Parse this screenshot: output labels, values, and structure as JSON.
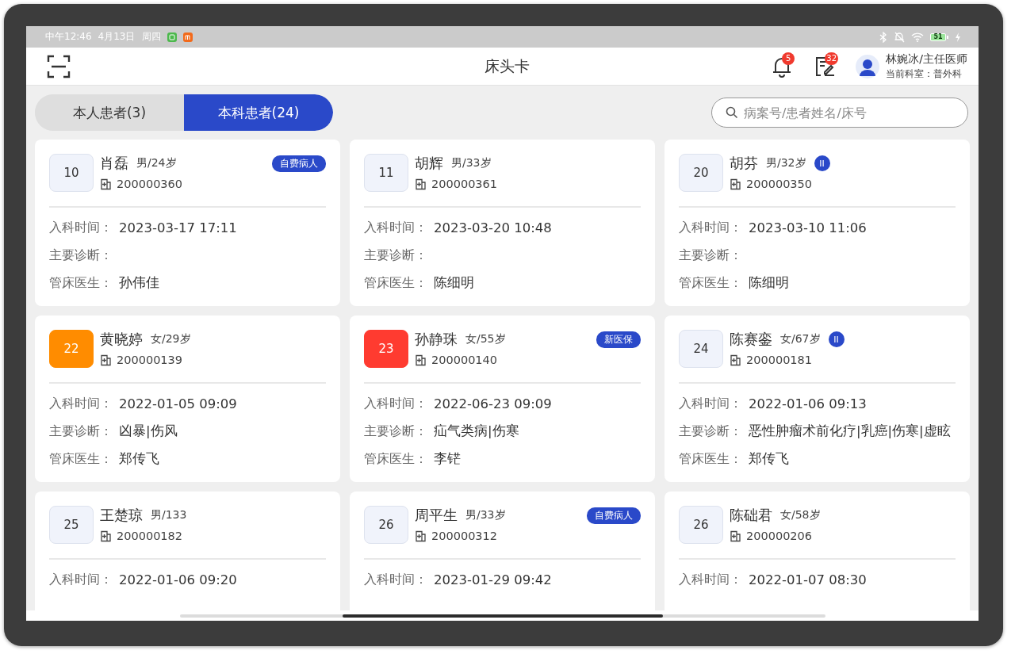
{
  "status_bar": {
    "time": "中午12:46",
    "date": "4月13日",
    "weekday": "周四",
    "battery": "51"
  },
  "header": {
    "title": "床头卡",
    "notifications": "5",
    "tasks": "32",
    "user": "林婉冰/主任医师",
    "department": "当前科室：普外科"
  },
  "tabs": [
    {
      "label": "本人患者(3)",
      "selected": false
    },
    {
      "label": "本科患者(24)",
      "selected": true
    }
  ],
  "search": {
    "placeholder": "病案号/患者姓名/床号"
  },
  "cards": [
    {
      "bed": "10",
      "color": "#f0f3fb",
      "name": "肖磊",
      "sex_age": "男/24岁",
      "tag": {
        "kind": "pill",
        "text": "自费病人"
      },
      "record_no": "200000360",
      "fields": [
        {
          "label": "入科时间：",
          "value": "2023-03-17 17:11"
        },
        {
          "label": "主要诊断："
        },
        {
          "label": "管床医生：",
          "value": "孙伟佳"
        }
      ]
    },
    {
      "bed": "11",
      "color": "#f0f3fb",
      "name": "胡辉",
      "sex_age": "男/33岁",
      "record_no": "200000361",
      "fields": [
        {
          "label": "入科时间：",
          "value": "2023-03-20 10:48"
        },
        {
          "label": "主要诊断："
        },
        {
          "label": "管床医生：",
          "value": "陈细明"
        }
      ]
    },
    {
      "bed": "20",
      "color": "#f0f3fb",
      "name": "胡芬",
      "sex_age": "男/32岁",
      "tag": {
        "kind": "circle",
        "text": "II"
      },
      "record_no": "200000350",
      "fields": [
        {
          "label": "入科时间：",
          "value": "2023-03-10 11:06"
        },
        {
          "label": "主要诊断："
        },
        {
          "label": "管床医生：",
          "value": "陈细明"
        }
      ]
    },
    {
      "bed": "22",
      "color": "#ff8c00",
      "name": "黄晓婷",
      "sex_age": "女/29岁",
      "record_no": "200000139",
      "fields": [
        {
          "label": "入科时间：",
          "value": "2022-01-05 09:09"
        },
        {
          "label": "主要诊断：",
          "value": "凶暴|伤风"
        },
        {
          "label": "管床医生：",
          "value": "郑传飞"
        }
      ]
    },
    {
      "bed": "23",
      "color": "#ff3b30",
      "name": "孙静珠",
      "sex_age": "女/55岁",
      "tag": {
        "kind": "pill",
        "text": "新医保"
      },
      "record_no": "200000140",
      "fields": [
        {
          "label": "入科时间：",
          "value": "2022-06-23 09:09"
        },
        {
          "label": "主要诊断：",
          "value": "疝气类病|伤寒"
        },
        {
          "label": "管床医生：",
          "value": "李铓"
        }
      ]
    },
    {
      "bed": "24",
      "color": "#f0f3fb",
      "name": "陈赛銮",
      "sex_age": "女/67岁",
      "tag": {
        "kind": "circle",
        "text": "II"
      },
      "record_no": "200000181",
      "fields": [
        {
          "label": "入科时间：",
          "value": "2022-01-06 09:13"
        },
        {
          "label": "主要诊断：",
          "value": "恶性肿瘤术前化疗|乳癌|伤寒|虚眩"
        },
        {
          "label": "管床医生：",
          "value": "郑传飞"
        }
      ]
    },
    {
      "bed": "25",
      "color": "#f0f3fb",
      "name": "王楚琼",
      "sex_age": "男/133",
      "record_no": "200000182",
      "fields": [
        {
          "label": "入科时间：",
          "value": "2022-01-06 09:20"
        }
      ]
    },
    {
      "bed": "26",
      "color": "#f0f3fb",
      "name": "周平生",
      "sex_age": "男/33岁",
      "tag": {
        "kind": "pill",
        "text": "自费病人"
      },
      "record_no": "200000312",
      "fields": [
        {
          "label": "入科时间：",
          "value": "2023-01-29 09:42"
        }
      ]
    },
    {
      "bed": "26",
      "color": "#f0f3fb",
      "name": "陈础君",
      "sex_age": "女/58岁",
      "record_no": "200000206",
      "fields": [
        {
          "label": "入科时间：",
          "value": "2022-01-07 08:30"
        }
      ]
    }
  ]
}
